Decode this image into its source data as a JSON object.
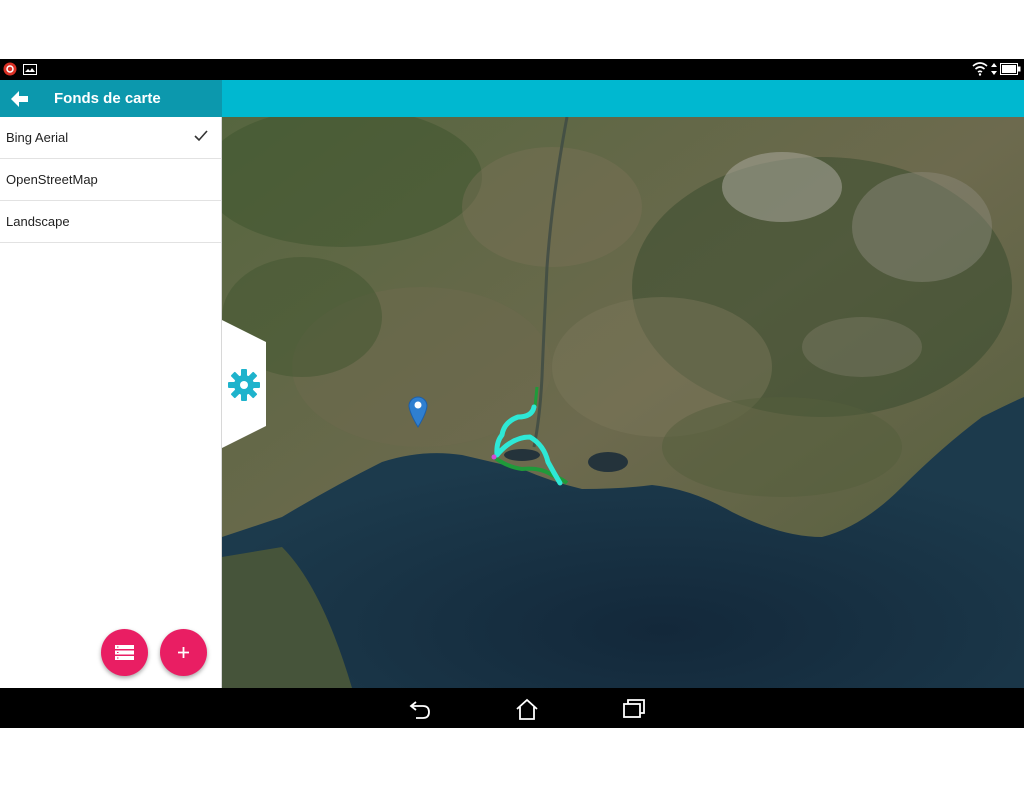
{
  "panel": {
    "title": "Fonds de carte",
    "items": [
      {
        "label": "Bing Aerial",
        "selected": true
      },
      {
        "label": "OpenStreetMap",
        "selected": false
      },
      {
        "label": "Landscape",
        "selected": false
      }
    ]
  },
  "colors": {
    "panel_header": "#0c98ad",
    "toolbar": "#00b8d0",
    "fab": "#e91e63",
    "route": "#2ee8d6",
    "marker": "#2f7fd0"
  },
  "icons": {
    "back": "arrow-back-icon",
    "check": "check-icon",
    "settings": "gear-icon",
    "marker": "map-pin-icon",
    "layers": "list-icon",
    "add": "plus-icon",
    "nav_back": "back-icon",
    "nav_home": "home-icon",
    "nav_recents": "recents-icon"
  }
}
